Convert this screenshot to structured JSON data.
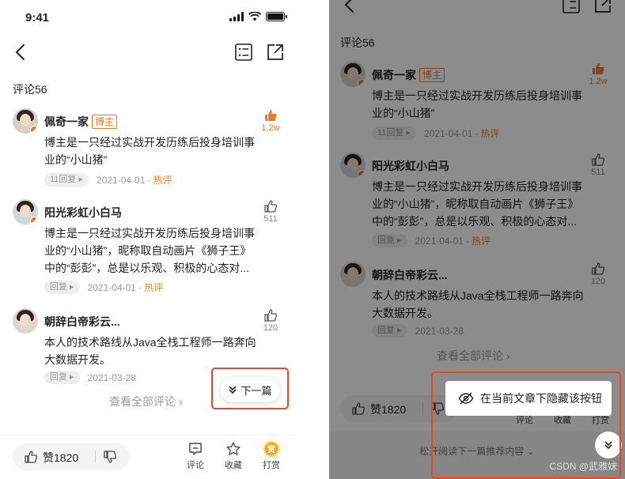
{
  "status_bar": {
    "time": "9:41"
  },
  "comments": {
    "title": "评论56",
    "items": [
      {
        "author": "佩奇一家",
        "tag": "博主",
        "text": "博主是一只经过实战开发历练后投身培训事业的“小山猪”",
        "replies": "11回复",
        "date": "2021-04-01",
        "hot": "热评",
        "likes": "1.2w",
        "liked": true
      },
      {
        "author": "阳光彩虹小白马",
        "text": "博主是一只经过实战开发历练后投身培训事业的“小山猪”，昵称取自动画片《狮子王》中的“彭彭”，总是以乐观、积极的心态对...",
        "replies": "回复",
        "date": "2021-04-01",
        "hot": "热评",
        "likes": "511",
        "liked": false
      },
      {
        "author": "朝辞白帝彩云...",
        "text": "本人的技术路线从Java全栈工程师一路奔向大数据开发。",
        "replies": "回复",
        "date": "2021-03-28",
        "likes": "120",
        "liked": false
      }
    ],
    "view_all": "查看全部评论 ›"
  },
  "next_button": {
    "label": "下一篇"
  },
  "bottom_bar": {
    "like_label": "赞1820",
    "comment_label": "评论",
    "favorite_label": "收藏",
    "reward_label": "打赏",
    "reward_coin": "赏"
  },
  "right_panel": {
    "hide_popup_label": "在当前文章下隐藏该按钮",
    "release_hint": "松开阅读下一篇推荐内容 ⌄"
  },
  "watermark": "CSDN @武雅妹",
  "colors": {
    "accent": "#f07a2c",
    "highlight": "#e24a2f",
    "meta": "#9a9a9a"
  }
}
